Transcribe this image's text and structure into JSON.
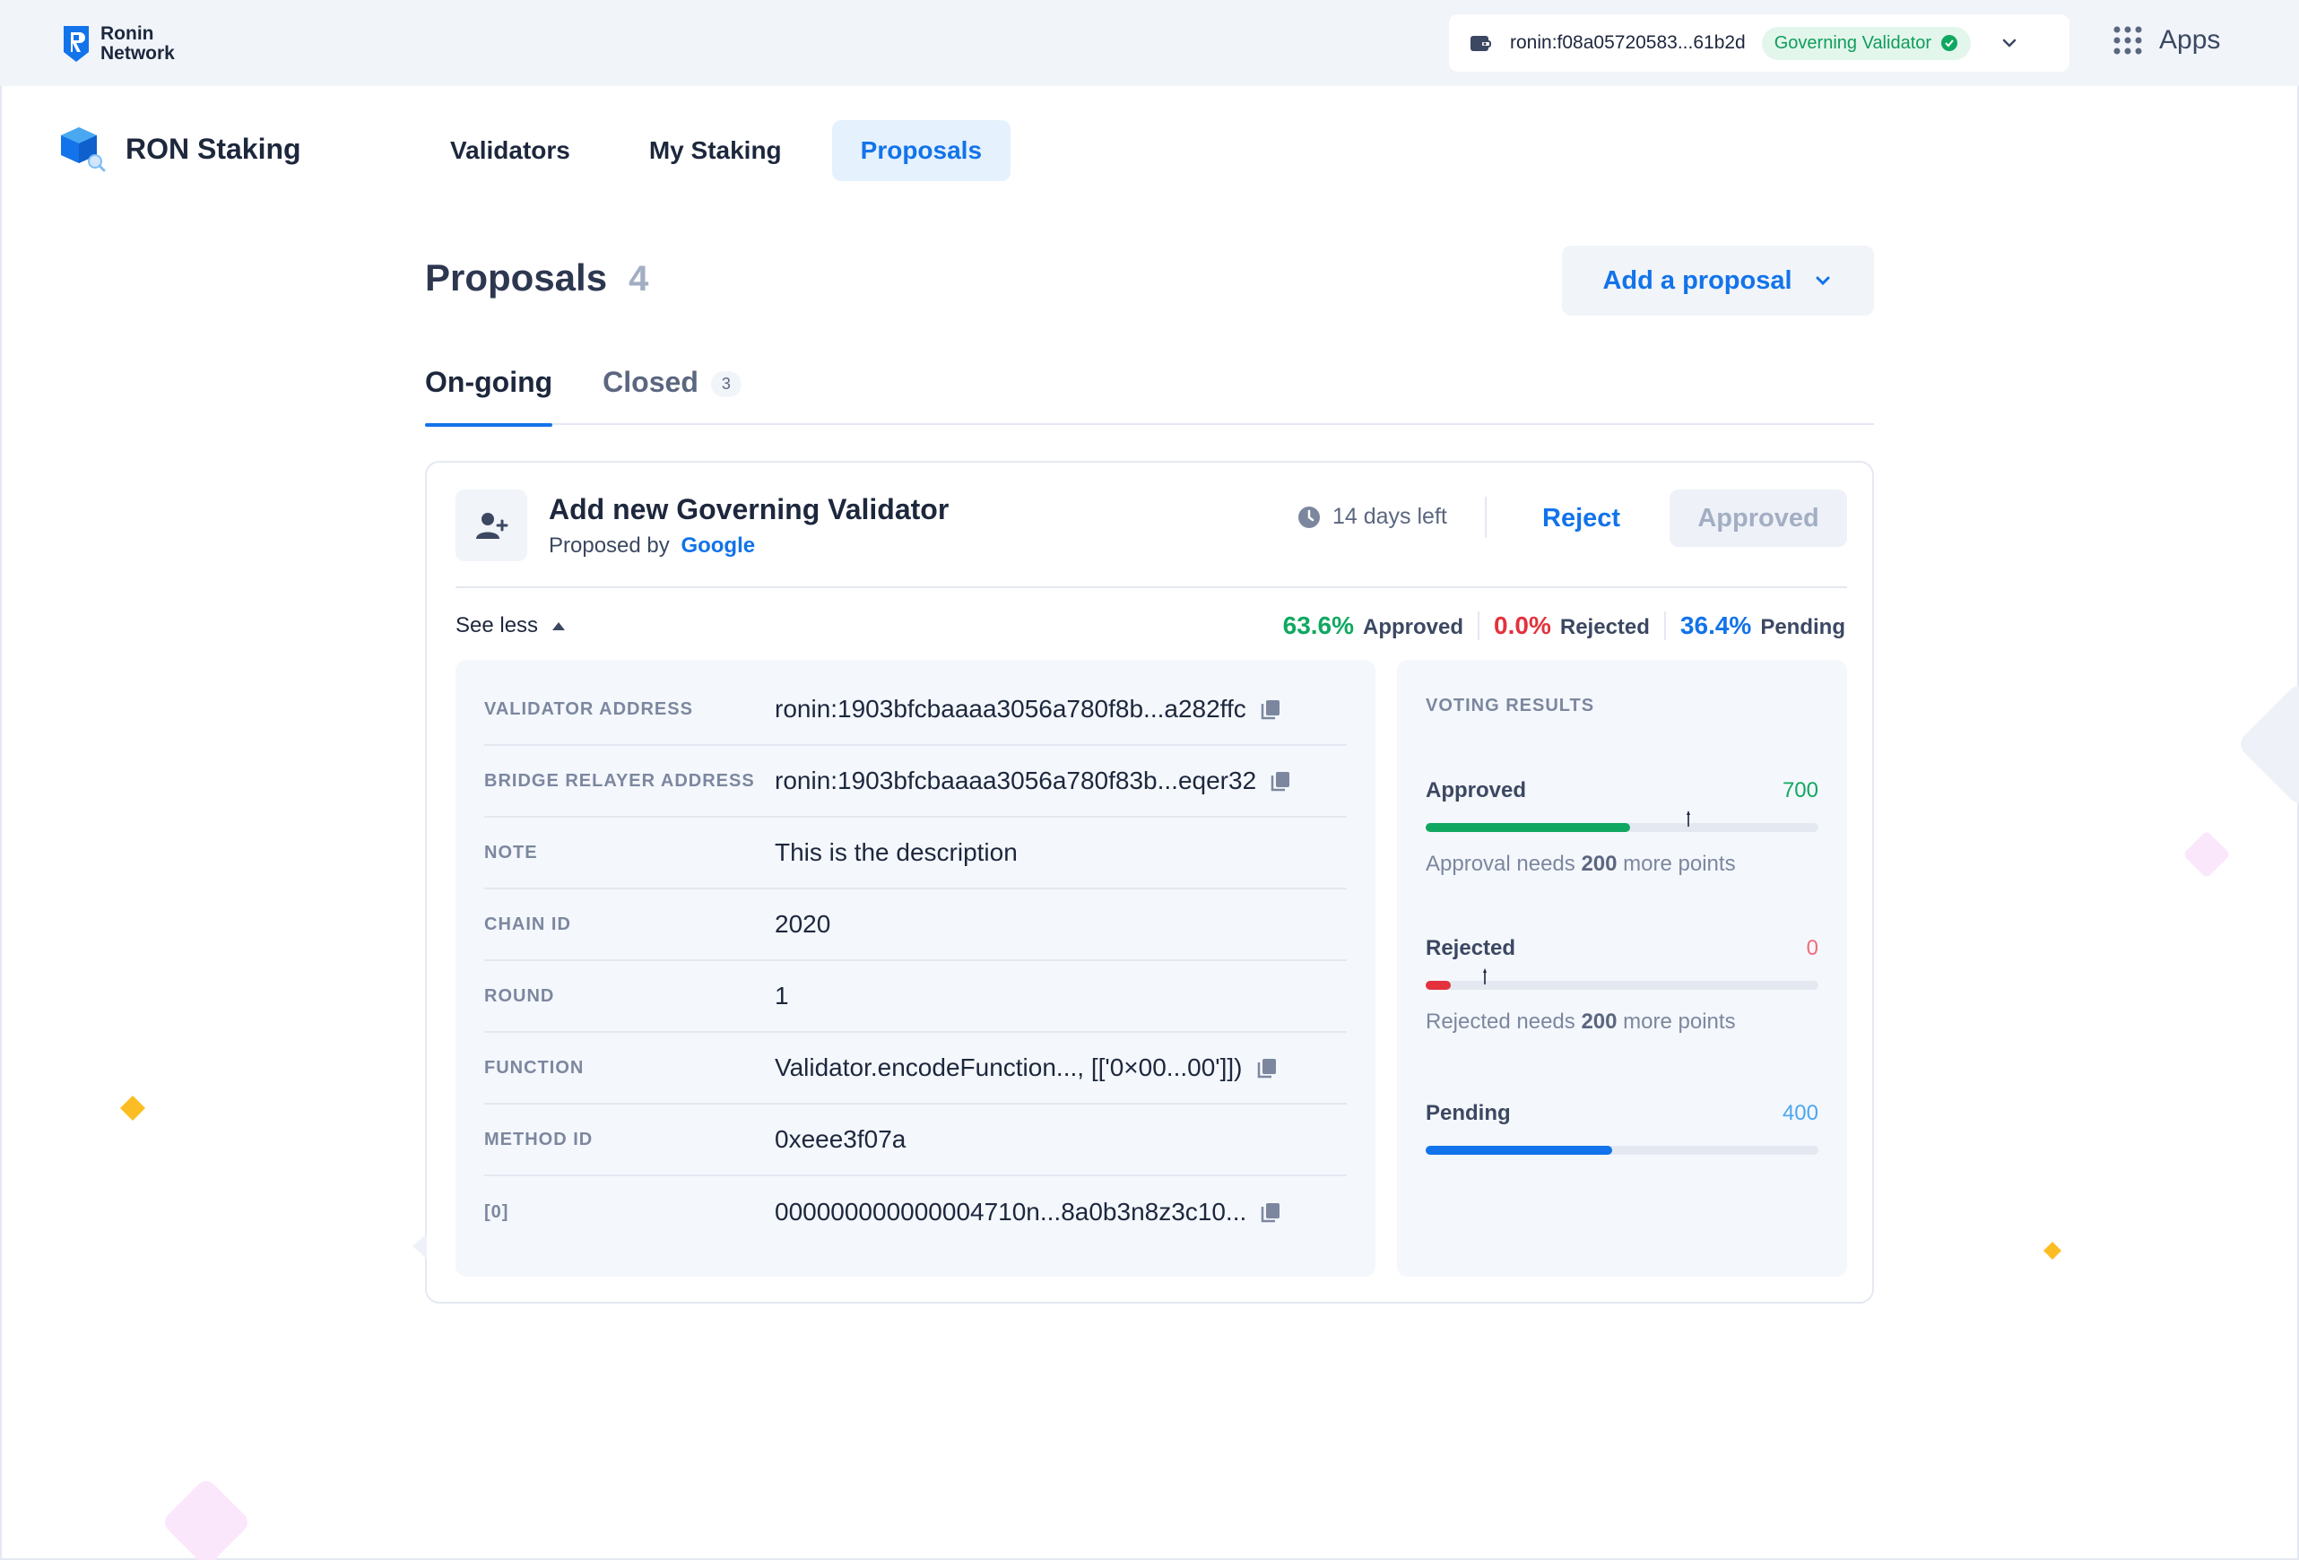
{
  "brand": {
    "logo_text": "Ronin\nNetwork",
    "app_name": "RON Staking"
  },
  "account": {
    "address": "ronin:f08a05720583...61b2d",
    "role_badge": "Governing Validator"
  },
  "apps": {
    "label": "Apps"
  },
  "nav": {
    "items": [
      {
        "label": "Validators",
        "active": false
      },
      {
        "label": "My Staking",
        "active": false
      },
      {
        "label": "Proposals",
        "active": true
      }
    ]
  },
  "page": {
    "title": "Proposals",
    "count": "4",
    "add_button": "Add a proposal"
  },
  "tabs": {
    "ongoing": "On-going",
    "closed": "Closed",
    "closed_count": "3"
  },
  "proposal": {
    "title": "Add new Governing Validator",
    "proposed_by_label": "Proposed by",
    "proposer": "Google",
    "time_left": "14 days left",
    "reject_label": "Reject",
    "approved_label": "Approved",
    "see_less": "See less",
    "summary": {
      "approved_pct": "63.6%",
      "approved_label": "Approved",
      "rejected_pct": "0.0%",
      "rejected_label": "Rejected",
      "pending_pct": "36.4%",
      "pending_label": "Pending"
    },
    "details": [
      {
        "key": "VALIDATOR ADDRESS",
        "value": "ronin:1903bfcbaaaa3056a780f8b...a282ffc",
        "copy": true
      },
      {
        "key": "BRIDGE RELAYER ADDRESS",
        "value": "ronin:1903bfcbaaaa3056a780f83b...eqer32",
        "copy": true
      },
      {
        "key": "NOTE",
        "value": "This is the description",
        "copy": false
      },
      {
        "key": "CHAIN ID",
        "value": "2020",
        "copy": false
      },
      {
        "key": "ROUND",
        "value": "1",
        "copy": false
      },
      {
        "key": "FUNCTION",
        "value": "Validator.encodeFunction..., [['0×00...00']])",
        "copy": true
      },
      {
        "key": "METHOD ID",
        "value": "0xeee3f07a",
        "copy": false
      },
      {
        "key": "[0]",
        "value": "000000000000004710n...8a0b3n8z3c10...",
        "copy": true
      }
    ],
    "voting": {
      "title": "VOTING RESULTS",
      "approved": {
        "label": "Approved",
        "value": "700",
        "fill": 0.52,
        "threshold": 0.67,
        "note_prefix": "Approval needs",
        "note_points": "200",
        "note_suffix": "more points"
      },
      "rejected": {
        "label": "Rejected",
        "value": "0",
        "fill": 0.065,
        "threshold": 0.15,
        "note_prefix": "Rejected needs",
        "note_points": "200",
        "note_suffix": "more points"
      },
      "pending": {
        "label": "Pending",
        "value": "400",
        "fill": 0.475
      }
    }
  },
  "colors": {
    "accent": "#1273ea",
    "approved": "#10a861",
    "rejected": "#e3323d",
    "pending": "#1273ea",
    "pending_value": "#4aa8f0",
    "rejected_value": "#f26b7b"
  },
  "icons": [
    "ronin-logo-icon",
    "wallet-icon",
    "check-circle-icon",
    "chevron-down-icon",
    "apps-grid-icon",
    "ron-staking-cube-icon",
    "user-add-icon",
    "clock-icon",
    "triangle-up-icon",
    "copy-icon"
  ]
}
